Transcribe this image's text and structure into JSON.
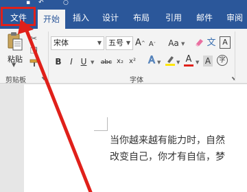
{
  "tabs": {
    "file": "文件",
    "home": "开始",
    "insert": "插入",
    "design": "设计",
    "layout": "布局",
    "references": "引用",
    "mailings": "邮件",
    "review": "审阅"
  },
  "clipboard": {
    "paste_label": "粘贴",
    "group_label": "剪贴板"
  },
  "font": {
    "font_name": "宋体",
    "font_size": "五号",
    "grow_label": "A",
    "shrink_label": "A",
    "case_label": "Aa",
    "bold": "B",
    "italic": "I",
    "underline": "U",
    "strikethrough": "abc",
    "subscript": "x₂",
    "superscript": "x²",
    "text_effects": "A",
    "font_color": "A",
    "char_shading": "A",
    "enclose": "字",
    "group_label": "字体"
  },
  "document": {
    "line1": "当你越来越有能力时，自然",
    "line2": "改变自己，你才有自信，梦"
  },
  "colors": {
    "ribbon_blue": "#2b579a",
    "highlight_red": "#e0201a",
    "highlight_yellow": "#ffe600",
    "font_red": "#e0201a"
  }
}
